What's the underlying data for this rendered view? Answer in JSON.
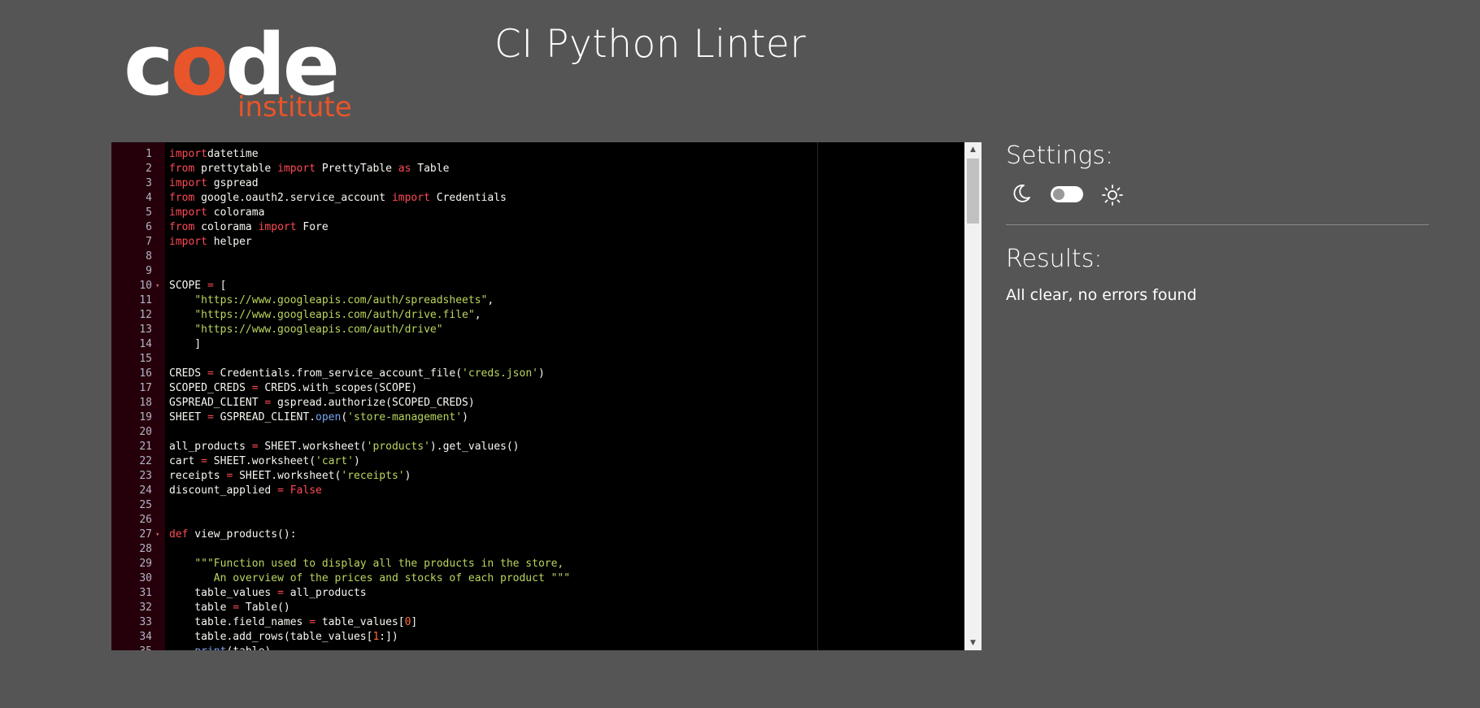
{
  "logo": {
    "word_letters": [
      {
        "ch": "c",
        "color": "#ffffff"
      },
      {
        "ch": "o",
        "color": "#e8552a"
      },
      {
        "ch": "d",
        "color": "#ffffff"
      },
      {
        "ch": "e",
        "color": "#ffffff"
      }
    ],
    "subtitle": "institute"
  },
  "page_title": "CI Python Linter",
  "settings": {
    "heading": "Settings:",
    "dark_icon": "moon-icon",
    "light_icon": "sun-icon",
    "toggle_state": "off"
  },
  "results": {
    "heading": "Results:",
    "message": "All clear, no errors found"
  },
  "colors": {
    "background": "#555555",
    "editor_bg": "#000000",
    "gutter_bg": "#25000a",
    "keyword": "#ff4a55",
    "string": "#b9d65e",
    "function": "#7ba6f0",
    "number": "#ff6b3d",
    "brand_orange": "#e8552a"
  },
  "editor": {
    "fold_markers": [
      10,
      27
    ],
    "lines": [
      [
        [
          "kw",
          "import"
        ],
        [
          "",
          "datetime"
        ]
      ],
      [
        [
          "kw",
          "from"
        ],
        [
          "",
          " prettytable "
        ],
        [
          "kw",
          "import"
        ],
        [
          "",
          " PrettyTable "
        ],
        [
          "kw",
          "as"
        ],
        [
          "",
          " Table"
        ]
      ],
      [
        [
          "kw",
          "import"
        ],
        [
          "",
          " gspread"
        ]
      ],
      [
        [
          "kw",
          "from"
        ],
        [
          "",
          " google.oauth2.service_account "
        ],
        [
          "kw",
          "import"
        ],
        [
          "",
          " Credentials"
        ]
      ],
      [
        [
          "kw",
          "import"
        ],
        [
          "",
          " colorama"
        ]
      ],
      [
        [
          "kw",
          "from"
        ],
        [
          "",
          " colorama "
        ],
        [
          "kw",
          "import"
        ],
        [
          "",
          " Fore"
        ]
      ],
      [
        [
          "kw",
          "import"
        ],
        [
          "",
          " helper"
        ]
      ],
      [],
      [],
      [
        [
          "",
          "SCOPE "
        ],
        [
          "kw",
          "="
        ],
        [
          "",
          " ["
        ]
      ],
      [
        [
          "",
          "    "
        ],
        [
          "str",
          "\"https://www.googleapis.com/auth/spreadsheets\""
        ],
        [
          "",
          ","
        ]
      ],
      [
        [
          "",
          "    "
        ],
        [
          "str",
          "\"https://www.googleapis.com/auth/drive.file\""
        ],
        [
          "",
          ","
        ]
      ],
      [
        [
          "",
          "    "
        ],
        [
          "str",
          "\"https://www.googleapis.com/auth/drive\""
        ]
      ],
      [
        [
          "",
          "    ]"
        ]
      ],
      [],
      [
        [
          "",
          "CREDS "
        ],
        [
          "kw",
          "="
        ],
        [
          "",
          " Credentials.from_service_account_file("
        ],
        [
          "str",
          "'creds.json'"
        ],
        [
          "",
          ")"
        ]
      ],
      [
        [
          "",
          "SCOPED_CREDS "
        ],
        [
          "kw",
          "="
        ],
        [
          "",
          " CREDS.with_scopes(SCOPE)"
        ]
      ],
      [
        [
          "",
          "GSPREAD_CLIENT "
        ],
        [
          "kw",
          "="
        ],
        [
          "",
          " gspread.authorize(SCOPED_CREDS)"
        ]
      ],
      [
        [
          "",
          "SHEET "
        ],
        [
          "kw",
          "="
        ],
        [
          "",
          " GSPREAD_CLIENT."
        ],
        [
          "fn",
          "open"
        ],
        [
          "",
          "("
        ],
        [
          "str",
          "'store-management'"
        ],
        [
          "",
          ")"
        ]
      ],
      [],
      [
        [
          "",
          "all_products "
        ],
        [
          "kw",
          "="
        ],
        [
          "",
          " SHEET.worksheet("
        ],
        [
          "str",
          "'products'"
        ],
        [
          "",
          ").get_values()"
        ]
      ],
      [
        [
          "",
          "cart "
        ],
        [
          "kw",
          "="
        ],
        [
          "",
          " SHEET.worksheet("
        ],
        [
          "str",
          "'cart'"
        ],
        [
          "",
          ")"
        ]
      ],
      [
        [
          "",
          "receipts "
        ],
        [
          "kw",
          "="
        ],
        [
          "",
          " SHEET.worksheet("
        ],
        [
          "str",
          "'receipts'"
        ],
        [
          "",
          ")"
        ]
      ],
      [
        [
          "",
          "discount_applied "
        ],
        [
          "kw",
          "="
        ],
        [
          "",
          " "
        ],
        [
          "kw",
          "False"
        ]
      ],
      [],
      [],
      [
        [
          "kw",
          "def"
        ],
        [
          "",
          " view_products():"
        ]
      ],
      [],
      [
        [
          "",
          "    "
        ],
        [
          "str",
          "\"\"\"Function used to display all the products in the store,"
        ]
      ],
      [
        [
          "",
          "       "
        ],
        [
          "str",
          "An overview of the prices and stocks of each product \"\"\""
        ]
      ],
      [
        [
          "",
          "    table_values "
        ],
        [
          "kw",
          "="
        ],
        [
          "",
          " all_products"
        ]
      ],
      [
        [
          "",
          "    table "
        ],
        [
          "kw",
          "="
        ],
        [
          "",
          " Table()"
        ]
      ],
      [
        [
          "",
          "    table.field_names "
        ],
        [
          "kw",
          "="
        ],
        [
          "",
          " table_values["
        ],
        [
          "num",
          "0"
        ],
        [
          "",
          "]"
        ]
      ],
      [
        [
          "",
          "    table.add_rows(table_values["
        ],
        [
          "num",
          "1"
        ],
        [
          "",
          ":])"
        ]
      ],
      [
        [
          "",
          "    "
        ],
        [
          "fn",
          "print"
        ],
        [
          "",
          "(table)"
        ]
      ]
    ]
  }
}
